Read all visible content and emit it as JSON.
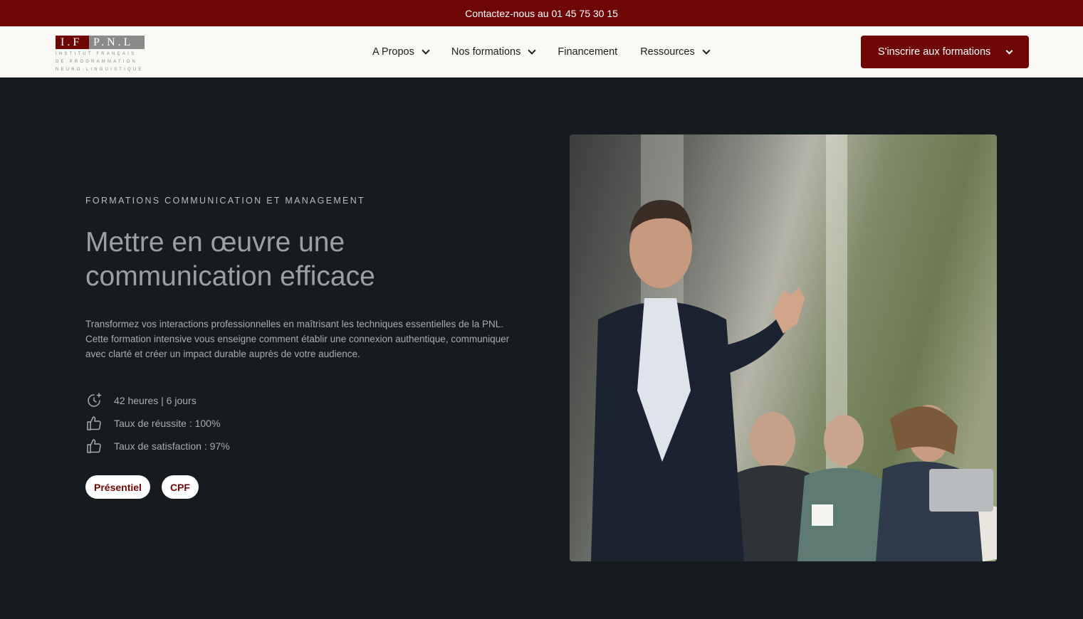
{
  "topbar": {
    "contact": "Contactez-nous au 01 45 75 30 15"
  },
  "logo": {
    "mark_left": "I.F",
    "mark_right": "P.N.L",
    "lines": [
      "INSTITUT FRANÇAIS",
      "DE PROGRAMMATION",
      "NEURO-LINGUISTIQUE"
    ]
  },
  "nav": {
    "items": [
      {
        "label": "A Propos",
        "has_dropdown": true
      },
      {
        "label": "Nos formations",
        "has_dropdown": true
      },
      {
        "label": "Financement",
        "has_dropdown": false
      },
      {
        "label": "Ressources",
        "has_dropdown": true
      }
    ],
    "cta": "S'inscrire aux formations"
  },
  "hero": {
    "eyebrow": "FORMATIONS COMMUNICATION ET MANAGEMENT",
    "title": "Mettre en œuvre une communication efficace",
    "description": "Transformez vos interactions professionnelles en maîtrisant les techniques essentielles de la PNL. Cette formation intensive vous enseigne comment établir une connexion authentique, communiquer avec clarté et créer un impact durable auprès de votre audience.",
    "features": [
      {
        "icon": "clock-plus-icon",
        "text": "42 heures | 6 jours"
      },
      {
        "icon": "thumbs-up-icon",
        "text": "Taux de réussite : 100%"
      },
      {
        "icon": "thumbs-up-icon",
        "text": "Taux de satisfaction : 97%"
      }
    ],
    "tags": [
      "Présentiel",
      "CPF"
    ]
  },
  "colors": {
    "brand": "#6e0606",
    "background": "#161b1f",
    "nav_bg": "#faf8f4"
  }
}
